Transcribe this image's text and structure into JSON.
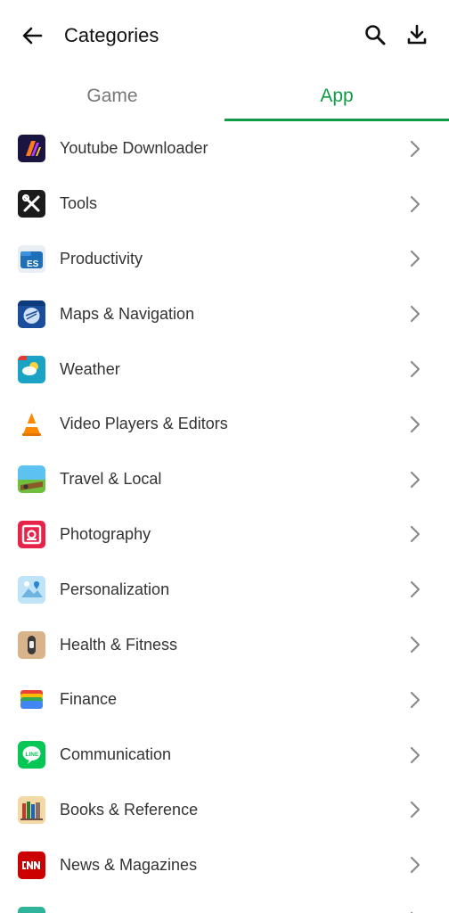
{
  "header": {
    "title": "Categories",
    "back_icon": "arrow-left-icon",
    "search_icon": "search-icon",
    "download_icon": "download-icon"
  },
  "tabs": [
    {
      "label": "Game",
      "active": false
    },
    {
      "label": "App",
      "active": true
    }
  ],
  "accent_color": "#109a47",
  "categories": [
    {
      "label": "Youtube Downloader",
      "icon": "youtube-downloader-app-icon"
    },
    {
      "label": "Tools",
      "icon": "tools-app-icon"
    },
    {
      "label": "Productivity",
      "icon": "productivity-app-icon"
    },
    {
      "label": "Maps & Navigation",
      "icon": "maps-navigation-app-icon"
    },
    {
      "label": "Weather",
      "icon": "weather-app-icon"
    },
    {
      "label": "Video Players & Editors",
      "icon": "video-players-app-icon"
    },
    {
      "label": "Travel & Local",
      "icon": "travel-local-app-icon"
    },
    {
      "label": "Photography",
      "icon": "photography-app-icon"
    },
    {
      "label": "Personalization",
      "icon": "personalization-app-icon"
    },
    {
      "label": "Health & Fitness",
      "icon": "health-fitness-app-icon"
    },
    {
      "label": "Finance",
      "icon": "finance-app-icon"
    },
    {
      "label": "Communication",
      "icon": "communication-app-icon"
    },
    {
      "label": "Books & Reference",
      "icon": "books-reference-app-icon"
    },
    {
      "label": "News & Magazines",
      "icon": "news-magazines-app-icon"
    }
  ]
}
